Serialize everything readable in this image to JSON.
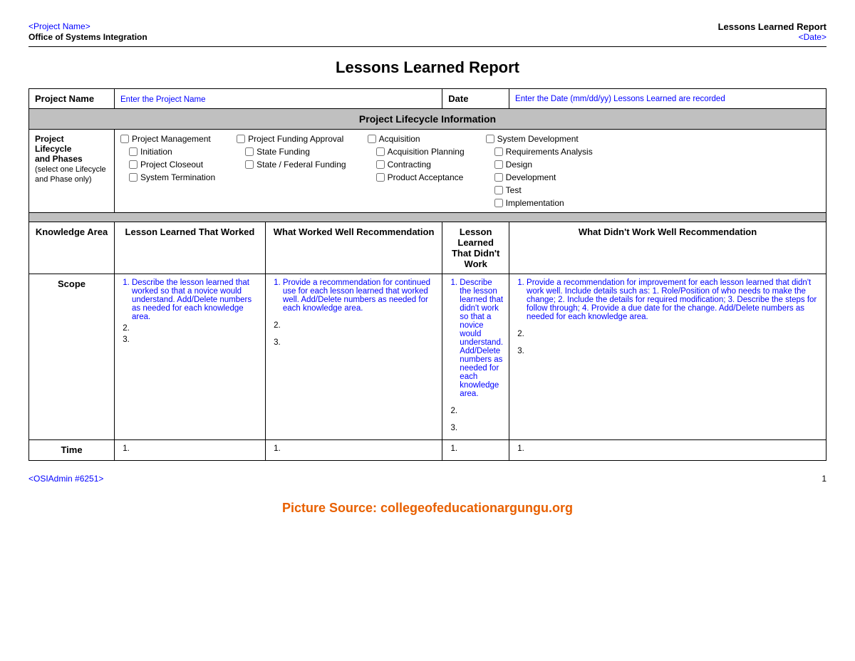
{
  "header": {
    "project_name_link": "<Project Name>",
    "org_name": "Office of Systems Integration",
    "report_title": "Lessons Learned Report",
    "date_link": "<Date>"
  },
  "main_title": "Lessons Learned Report",
  "project_row": {
    "project_label": "Project Name",
    "project_placeholder": "Enter the Project Name",
    "date_label": "Date",
    "date_placeholder": "Enter the Date (mm/dd/yy) Lessons Learned are recorded"
  },
  "lifecycle_section": {
    "header": "Project Lifecycle Information",
    "label_line1": "Project",
    "label_line2": "Lifecycle",
    "label_line3": "and Phases",
    "label_sub": "(select one Lifecycle and Phase only)",
    "columns": [
      {
        "items": [
          "Project Management",
          "Initiation",
          "Project Closeout",
          "System Termination"
        ]
      },
      {
        "items": [
          "Project Funding Approval",
          "State Funding",
          "State / Federal Funding"
        ]
      },
      {
        "items": [
          "Acquisition",
          "Acquisition Planning",
          "Contracting",
          "Product Acceptance"
        ]
      },
      {
        "items": [
          "System Development",
          "Requirements Analysis",
          "Design",
          "Development",
          "Test",
          "Implementation"
        ]
      }
    ]
  },
  "table_headers": {
    "knowledge_area": "Knowledge Area",
    "col1": "Lesson Learned That Worked",
    "col2": "What Worked Well Recommendation",
    "col3": "Lesson Learned That Didn't Work",
    "col4": "What Didn't Work Well Recommendation"
  },
  "rows": [
    {
      "area": "Scope",
      "col1": {
        "item1": "Describe the lesson learned that worked so that a novice would understand. Add/Delete numbers as needed for each knowledge area.",
        "item2": "",
        "item3": ""
      },
      "col2": {
        "item1": "Provide a recommendation for continued use for each lesson learned that worked well. Add/Delete numbers as needed for each knowledge area.",
        "item2": "",
        "item3": ""
      },
      "col3": {
        "item1": "Describe the lesson learned that didn't work so that a novice would understand. Add/Delete numbers as needed for each knowledge area.",
        "item2": "",
        "item3": ""
      },
      "col4": {
        "item1": "Provide a recommendation for improvement for each lesson learned that didn't work well. Include details such as: 1. Role/Position of who needs to make the change; 2. Include the details for required modification; 3. Describe the steps for follow through; 4. Provide a due date for the change. Add/Delete numbers as needed for each knowledge area.",
        "item2": "",
        "item3": ""
      }
    },
    {
      "area": "Time",
      "col1": {
        "item1": ""
      },
      "col2": {
        "item1": ""
      },
      "col3": {
        "item1": ""
      },
      "col4": {
        "item1": ""
      }
    }
  ],
  "footer": {
    "admin_link": "<OSIAdmin #6251>",
    "page_num": "1"
  },
  "source": "Picture Source: collegeofeducationargungu.org"
}
